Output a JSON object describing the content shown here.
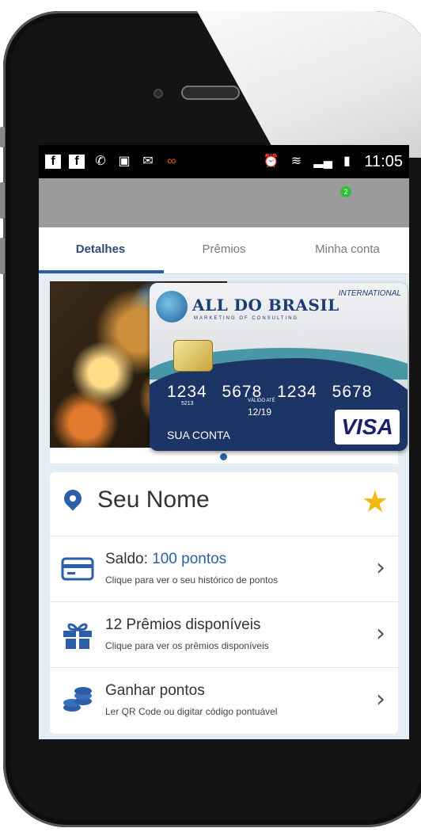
{
  "status_bar": {
    "time": "11:05",
    "left_icons": [
      "facebook-icon",
      "facebook-icon",
      "whatsapp-icon",
      "image-icon",
      "mail-icon",
      "glasses-icon"
    ],
    "right_icons": [
      "alarm-icon",
      "wifi-icon",
      "signal-icon",
      "battery-icon"
    ]
  },
  "app_bar": {
    "notification_count": "2"
  },
  "tabs": [
    {
      "label": "Detalhes",
      "active": true
    },
    {
      "label": "Prêmios",
      "active": false
    },
    {
      "label": "Minha conta",
      "active": false
    }
  ],
  "card": {
    "brand": "ALL DO BRASIL",
    "tagline": "MARKETING OF CONSULTING",
    "type": "INTERNATIONAL",
    "number": "1234 5678 1234 5678",
    "number_small": "5213",
    "valid_label": "VÁLIDO ATÉ",
    "expiry": "12/19",
    "holder": "SUA CONTA",
    "network": "VISA"
  },
  "profile": {
    "name": "Seu Nome"
  },
  "rows": [
    {
      "title_prefix": "Saldo: ",
      "title_highlight": "100 pontos",
      "subtitle": "Clique para ver o seu histórico de pontos",
      "icon": "credit-card-icon"
    },
    {
      "title": "12 Prêmios disponíveis",
      "subtitle": "Clique para ver os prêmios disponíveis",
      "icon": "gift-icon"
    },
    {
      "title": "Ganhar pontos",
      "subtitle": "Ler QR Code ou digitar código pontuável",
      "icon": "coins-icon"
    }
  ],
  "colors": {
    "accent": "#2d5ea8",
    "star": "#f2b90f",
    "app_bar": "#9b9b9b"
  }
}
